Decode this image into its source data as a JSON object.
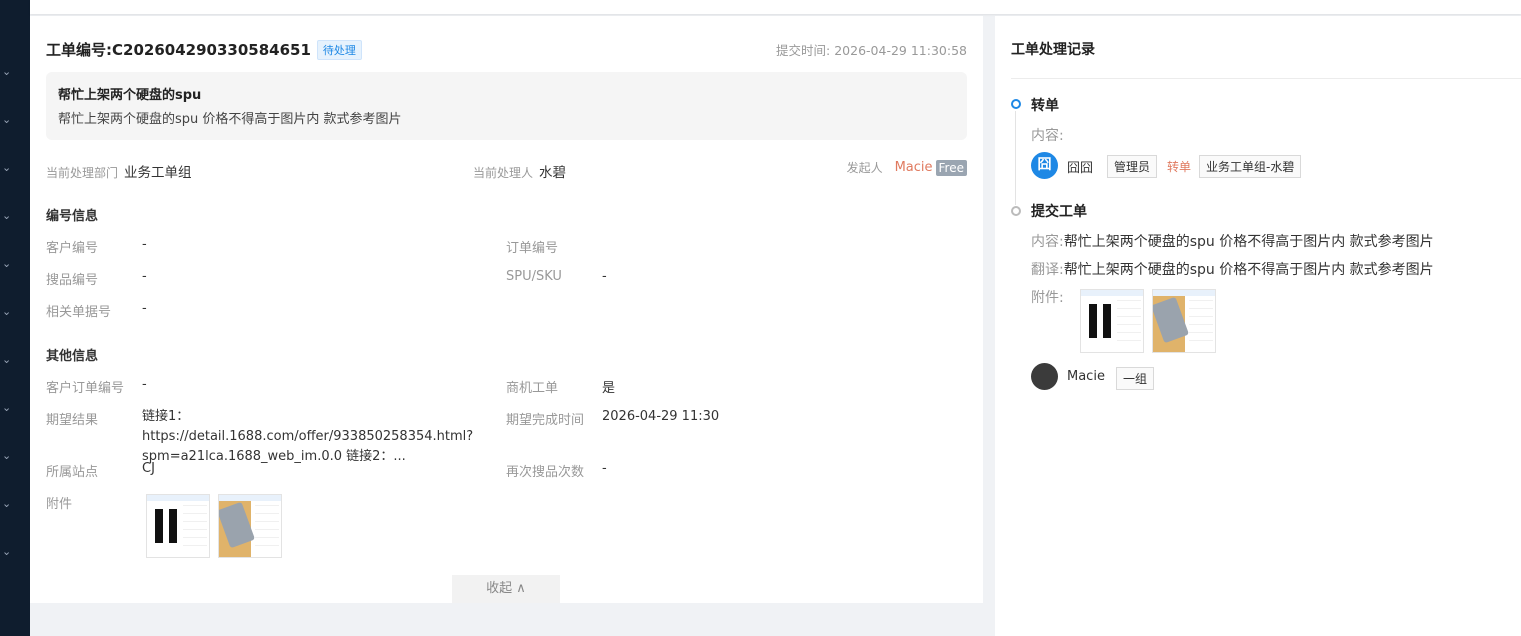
{
  "ticket": {
    "id_label": "工单编号: ",
    "id": "C202604290330584651",
    "status": "待处理",
    "submit_time": "提交时间: 2026-04-29 11:30:58"
  },
  "summary": {
    "title": "帮忙上架两个硬盘的spu",
    "content": "帮忙上架两个硬盘的spu 价格不得高于图片内 款式参考图片"
  },
  "meta": {
    "dept_label": "当前处理部门",
    "dept": "业务工单组",
    "handler_label": "当前处理人",
    "handler": "水碧",
    "initiator_label": "发起人",
    "initiator": "Macie",
    "initiator_badge": "Free"
  },
  "sections": {
    "number_info": "编号信息",
    "other_info": "其他信息"
  },
  "fields": {
    "customer_no_label": "客户编号",
    "customer_no": "-",
    "order_no_label": "订单编号",
    "order_no": "",
    "search_no_label": "搜品编号",
    "search_no": "-",
    "spu_label": "SPU/SKU",
    "spu": "-",
    "related_label": "相关单据号",
    "related": "-",
    "cust_order_label": "客户订单编号",
    "cust_order": "-",
    "biz_label": "商机工单",
    "biz": "是",
    "expect_label": "期望结果",
    "expect": "链接1：https://detail.1688.com/offer/933850258354.html?spm=a21lca.1688_web_im.0.0 链接2：...",
    "expect_time_label": "期望完成时间",
    "expect_time": "2026-04-29 11:30",
    "site_label": "所属站点",
    "site": "CJ",
    "research_label": "再次搜品次数",
    "research": "-",
    "attach_label": "附件"
  },
  "collapse_label": "收起 ∧",
  "records": {
    "title": "工单处理记录",
    "transfer": {
      "title": "转单",
      "content_label": "内容:",
      "user": "囧囧",
      "user_avatar": "囧",
      "role": "管理员",
      "action": "转单",
      "target": "业务工单组-水碧"
    },
    "submit": {
      "title": "提交工单",
      "content_label": "内容:",
      "content": "帮忙上架两个硬盘的spu 价格不得高于图片内 款式参考图片",
      "translate_label": "翻译:",
      "translate": "帮忙上架两个硬盘的spu 价格不得高于图片内 款式参考图片",
      "attach_label": "附件:",
      "user": "Macie",
      "group": "一组"
    }
  },
  "colors": {
    "accent": "#1e88e5",
    "sidebar": "#0f1d2e",
    "initiator": "#e07a5f"
  }
}
